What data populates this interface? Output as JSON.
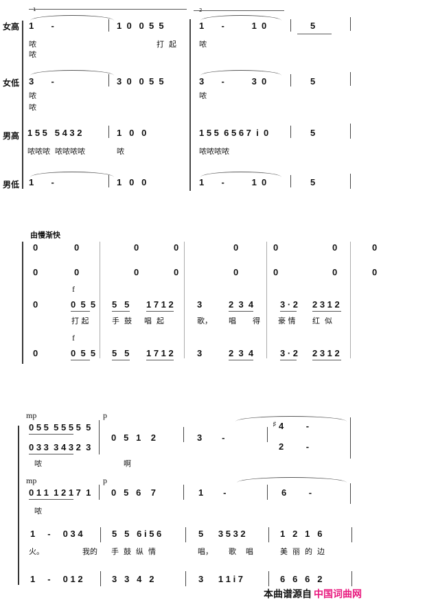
{
  "system1": {
    "labels": [
      "女高",
      "女低",
      "男高",
      "男低"
    ],
    "volta1": "1",
    "volta2": "2",
    "sop": [
      "1       -",
      "1  0   0  5  5",
      "1       -           1  0",
      "5"
    ],
    "sop_lyrics": [
      "哝",
      "哝",
      "打  起",
      "哝"
    ],
    "alto": [
      "3       -",
      "3  0   0  5  5",
      "3       -           3  0",
      "5"
    ],
    "alto_lyrics": [
      "哝",
      "哝",
      "哝"
    ],
    "ten": [
      "1 5 5   5 4 3 2",
      "1   0   0",
      "1 5 5  6 5 6 7  i  0",
      "5"
    ],
    "ten_lyrics": [
      "哝哝哝  哝哝哝哝",
      "哝",
      "哝哝哝哝"
    ],
    "bass": [
      "1       -",
      "1   0   0",
      "1       -           1  0",
      "5"
    ]
  },
  "system2": {
    "tempo": "由慢渐快",
    "row1": [
      "0",
      "0",
      "0",
      "0",
      "0",
      "0",
      "0",
      "0"
    ],
    "row2": [
      "0",
      "0",
      "0",
      "0",
      "0",
      "0",
      "0",
      "0"
    ],
    "dynamic": "f",
    "row3": [
      "0",
      "0  5  5",
      "5   5",
      "1 7 1 2",
      "3",
      "2  3  4",
      "3 · 2",
      "2 3 1 2"
    ],
    "row3_lyrics": [
      "打 起",
      "手  鼓",
      "唱  起",
      "歌，",
      "唱",
      "得",
      "豪 情",
      "红  似"
    ],
    "row4": [
      "0",
      "0  5  5",
      "5   5",
      "1 7 1 2",
      "3",
      "2  3  4",
      "3 · 2",
      "2 3 1 2"
    ]
  },
  "system3": {
    "mp": "mp",
    "p": "p",
    "row1a": "0 5 5  5 5 5 5  5",
    "row1b": "0 3 3  3 4 3 2  3",
    "row1_m2": "0   5   1    2",
    "row1_m3": "3        -",
    "row1_m4a": "4         -",
    "row1_m4b": "2         -",
    "sharp": "♯",
    "row1_lyrics": [
      "哝",
      "啊"
    ],
    "row2_m1": "0 1 1  1 2 1 7  1",
    "row2_m2": "0   5   6    7",
    "row2_m3": "1        -",
    "row2_m4": "6         -",
    "row2_lyrics": [
      "哝"
    ],
    "row3": [
      "1     -     0 3 4",
      "5   5   6 i 5 6",
      "5      3 5 3 2",
      "1   2   1   6"
    ],
    "row3_lyrics": [
      "火。",
      "我的",
      "手  鼓  纵  情",
      "唱，",
      "歌    唱",
      "美  丽  的  边"
    ],
    "row4": [
      "1     -     0 1 2",
      "3   3   4   2",
      "3      1 1 i 7",
      "6   6   6   2"
    ]
  },
  "footer": {
    "source": "本曲谱源自",
    "site": "中国词曲网",
    "site_color": "#e8177d"
  }
}
